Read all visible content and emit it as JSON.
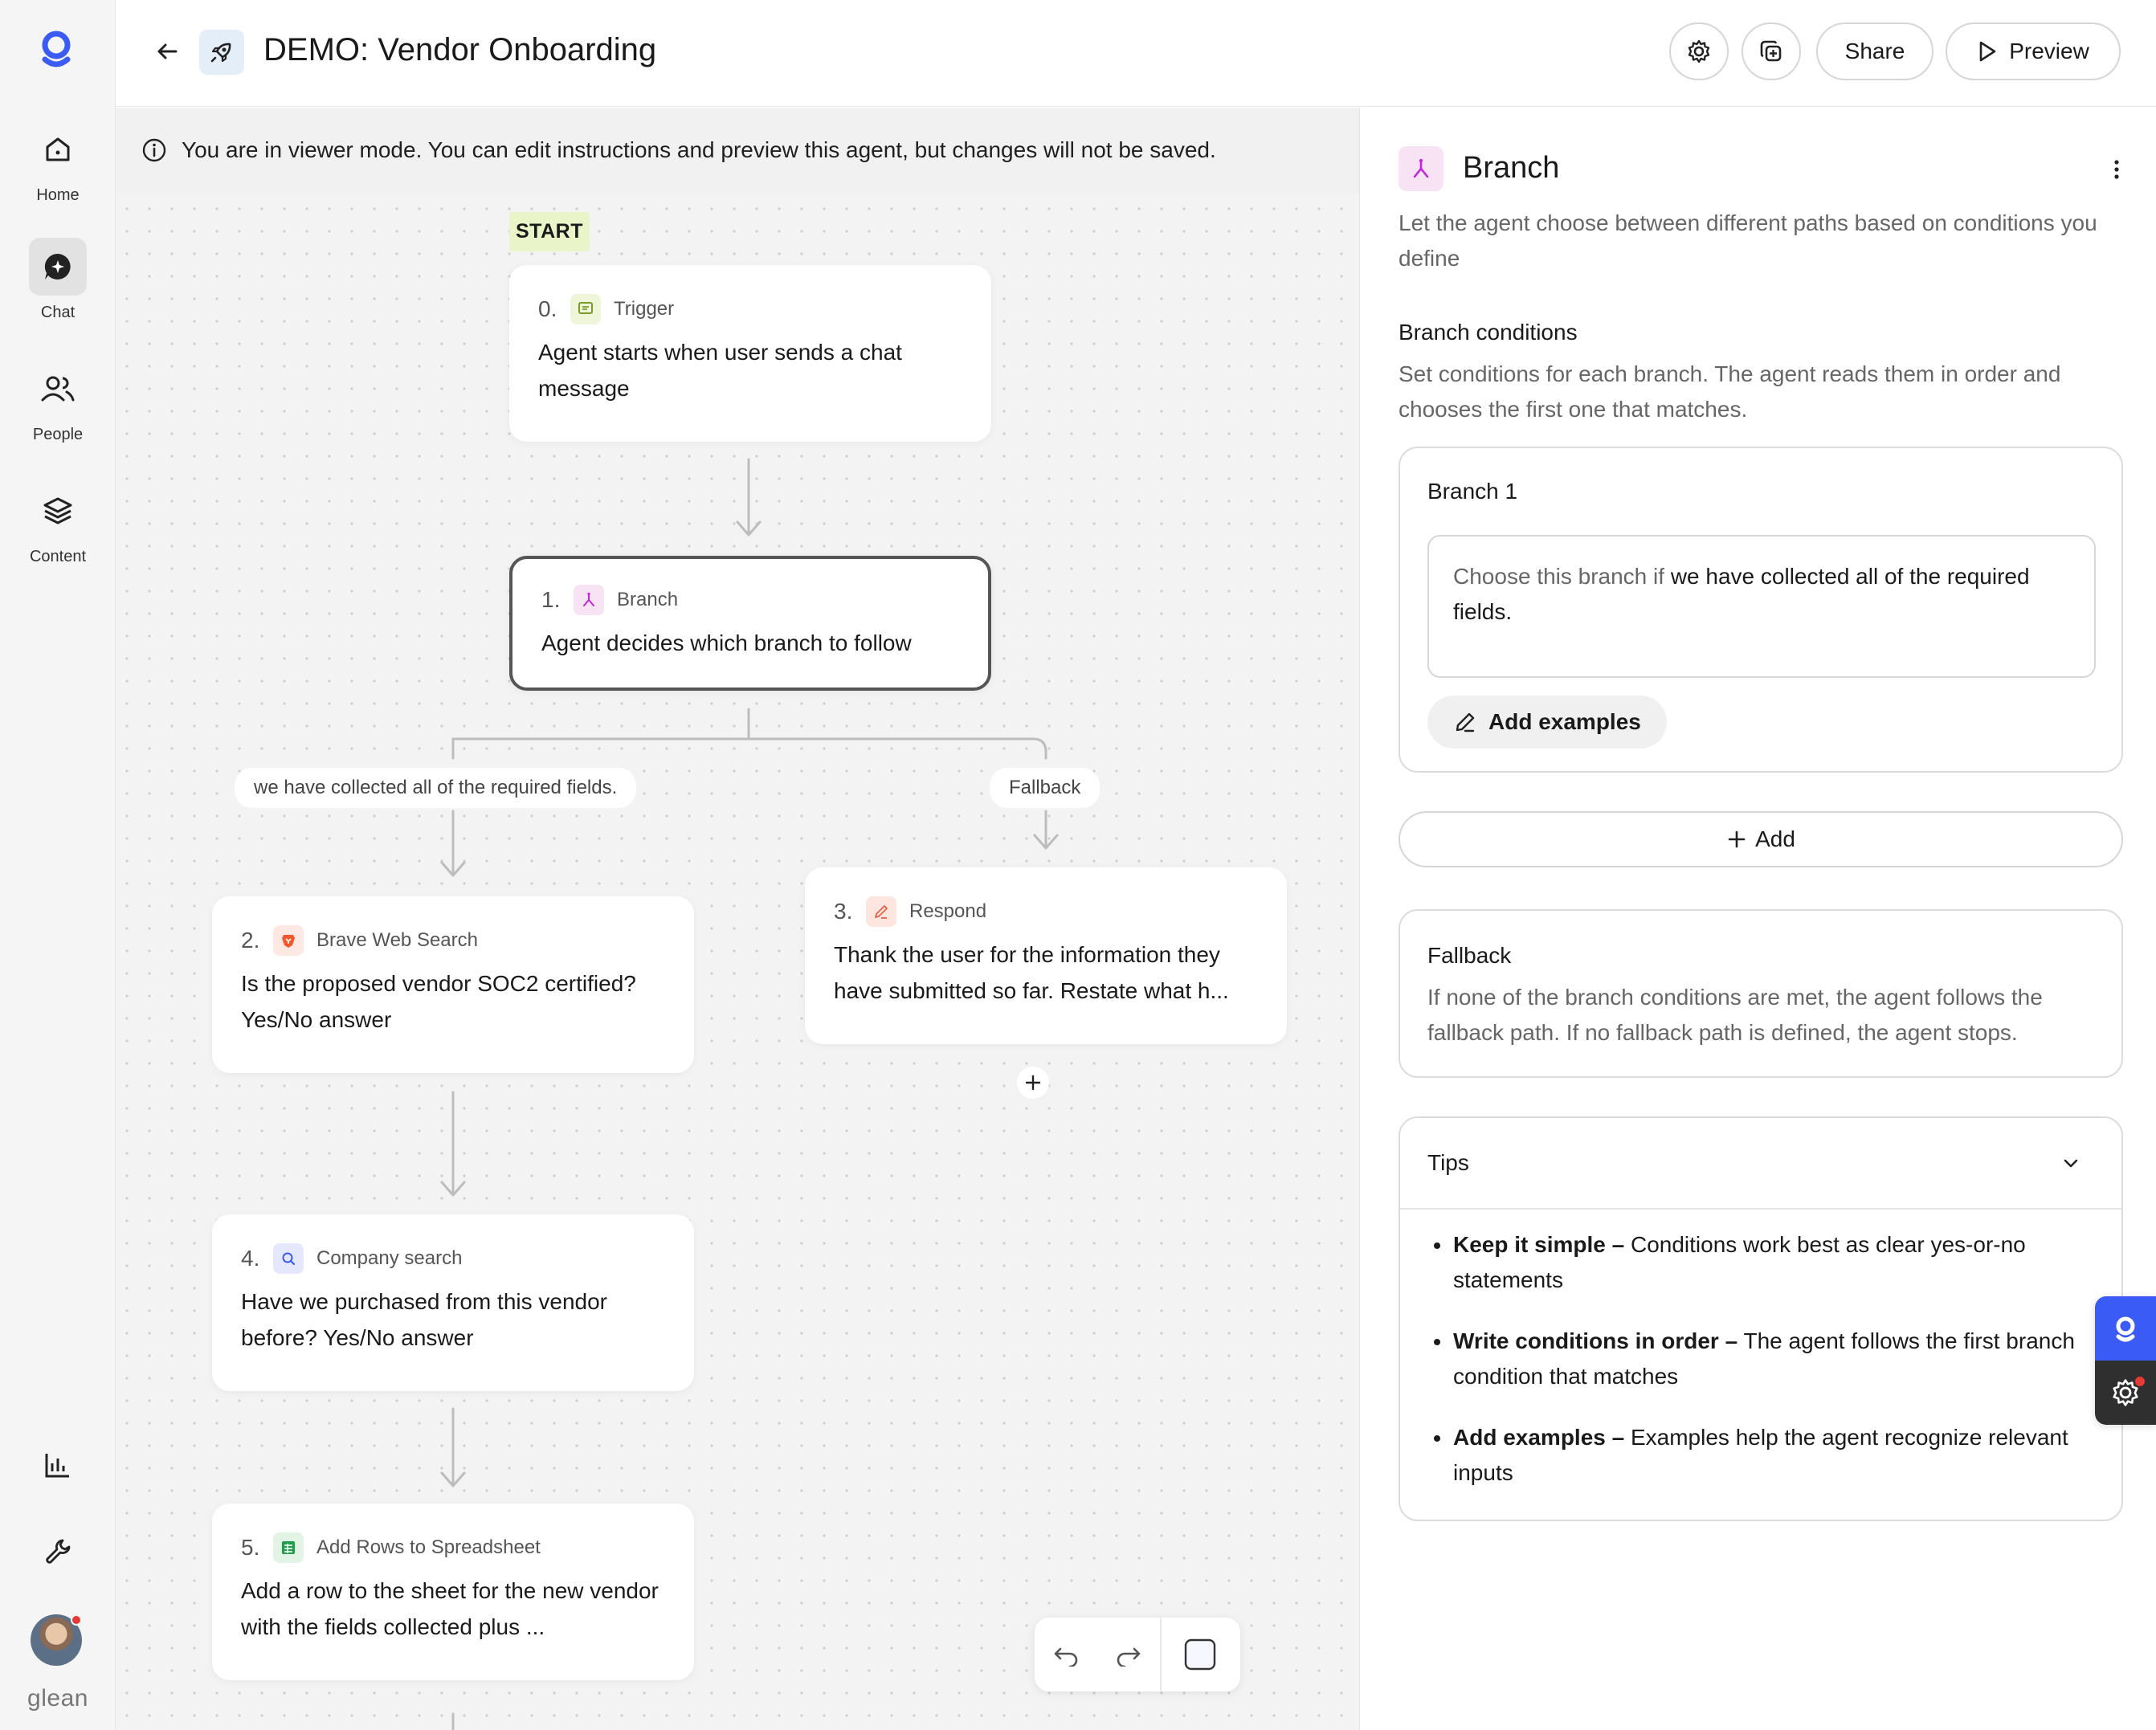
{
  "app": {
    "brand": "glean",
    "title": "DEMO: Vendor Onboarding",
    "colors": {
      "accent": "#3b5bf6",
      "branch": "#c026d3",
      "start": "#e9f5c8"
    }
  },
  "sidebar": {
    "items": [
      {
        "label": "Home",
        "icon": "home-icon"
      },
      {
        "label": "Chat",
        "icon": "chat-icon"
      },
      {
        "label": "People",
        "icon": "people-icon"
      },
      {
        "label": "Content",
        "icon": "layers-icon"
      }
    ]
  },
  "header": {
    "share_label": "Share",
    "preview_label": "Preview"
  },
  "canvas": {
    "banner": "You are in viewer mode. You can edit instructions and preview this agent, but changes will not be saved.",
    "start_label": "START",
    "nodes": [
      {
        "num": "0.",
        "type": "Trigger",
        "text": "Agent starts when user sends a chat message"
      },
      {
        "num": "1.",
        "type": "Branch",
        "text": "Agent decides which branch to follow"
      },
      {
        "num": "2.",
        "type": "Brave Web Search",
        "text": "Is the proposed vendor SOC2 certified? Yes/No answer"
      },
      {
        "num": "3.",
        "type": "Respond",
        "text": "Thank the user for the information they have submitted so far. Restate what h..."
      },
      {
        "num": "4.",
        "type": "Company search",
        "text": "Have we purchased from this vendor before? Yes/No answer"
      },
      {
        "num": "5.",
        "type": "Add Rows to Spreadsheet",
        "text": "Add a row to the sheet for the new vendor with the fields collected plus ..."
      }
    ],
    "edges": {
      "branch1": "we have collected all of the required fields.",
      "fallback": "Fallback"
    }
  },
  "panel": {
    "title": "Branch",
    "description": "Let the agent choose between different paths based on conditions you define",
    "conditions_title": "Branch conditions",
    "conditions_desc": "Set conditions for each branch. The agent reads them in order and chooses the first one that matches.",
    "branch1": {
      "title": "Branch 1",
      "prefix": "Choose this branch if",
      "condition": "we have collected all of the required fields.",
      "examples_label": "Add examples"
    },
    "add_label": "Add",
    "fallback": {
      "title": "Fallback",
      "desc": "If none of the branch conditions are met, the agent follows the fallback path. If no fallback path is defined, the agent stops."
    },
    "tips": {
      "title": "Tips",
      "items": [
        {
          "bold": "Keep it simple –",
          "text": "Conditions work best as clear yes-or-no statements"
        },
        {
          "bold": "Write conditions in order –",
          "text": "The agent follows the first branch condition that matches"
        },
        {
          "bold": "Add examples –",
          "text": "Examples help the agent recognize relevant inputs"
        }
      ]
    }
  }
}
